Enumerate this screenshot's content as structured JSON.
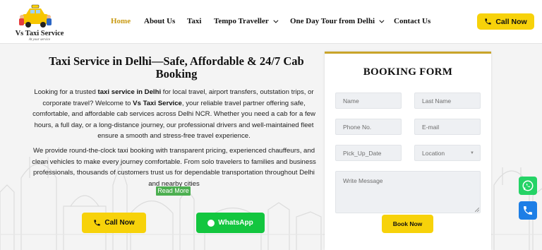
{
  "brand": {
    "name": "Vs Taxi Service",
    "tagline": "At your service"
  },
  "nav": {
    "items": [
      {
        "label": "Home",
        "active": true
      },
      {
        "label": "About Us"
      },
      {
        "label": "Taxi"
      },
      {
        "label": "Tempo Traveller",
        "dropdown": true
      },
      {
        "label": "One Day Tour from Delhi",
        "dropdown": true
      },
      {
        "label": "Contact Us"
      }
    ],
    "call_label": "Call Now"
  },
  "hero": {
    "title": "Taxi Service in Delhi—Safe, Affordable & 24/7 Cab Booking",
    "p1_a": "Looking for a trusted ",
    "p1_b": "taxi service in Delhi",
    "p1_c": " for local travel, airport transfers, outstation trips, or corporate travel? Welcome to ",
    "p1_d": "Vs Taxi Service",
    "p1_e": ", your reliable travel partner offering safe, comfortable, and affordable cab services across Delhi NCR. Whether you need a cab for a few hours, a full day, or a long-distance journey, our professional drivers and well-maintained fleet ensure a smooth and stress-free travel experience.",
    "p2": "We provide round-the-clock taxi booking with transparent pricing, experienced chauffeurs, and clean vehicles to make every journey comfortable. From solo travelers to families and business professionals, thousands of customers trust us for dependable transportation throughout Delhi and nearby cities",
    "read_more": "Read More",
    "call_label": "Call Now",
    "whatsapp_label": "WhatsApp"
  },
  "booking_form": {
    "title": "BOOKING FORM",
    "name_placeholder": "Name",
    "last_name_placeholder": "Last Name",
    "phone_placeholder": "Phone No.",
    "email_placeholder": "E-mail",
    "date_placeholder": "Pick_Up_Date",
    "location_placeholder": "Location",
    "message_placeholder": "Write Message",
    "submit_label": "Book Now"
  },
  "colors": {
    "accent_yellow": "#f7d20a",
    "nav_active": "#c99a12",
    "whatsapp_green": "#13c63f",
    "call_blue": "#1d7ee6",
    "form_border_gold": "#c9a42a"
  }
}
